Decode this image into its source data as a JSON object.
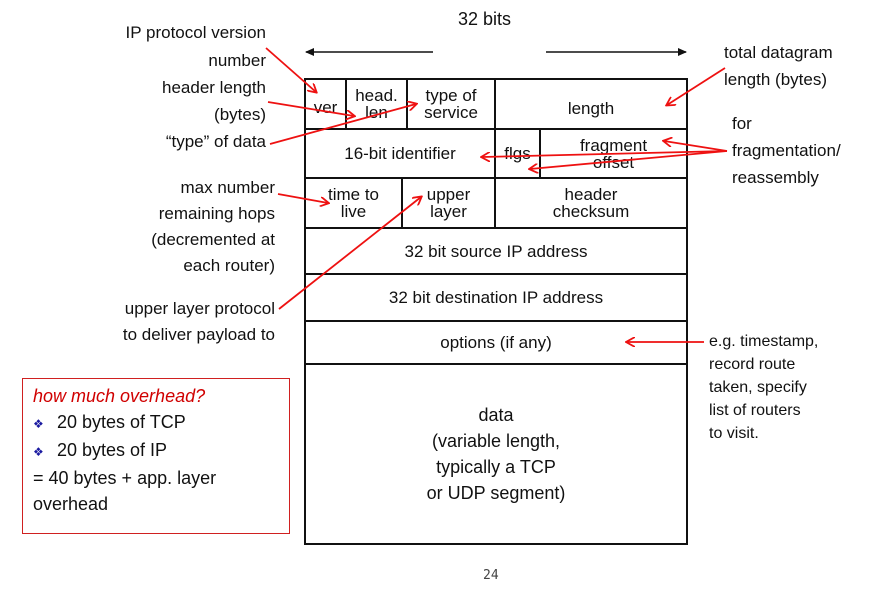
{
  "header": {
    "width_label": "32 bits"
  },
  "fields": {
    "ver": "ver",
    "head_len_1": "head.",
    "head_len_2": "len",
    "tos_1": "type of",
    "tos_2": "service",
    "length": "length",
    "identifier": "16-bit identifier",
    "flgs": "flgs",
    "frag_1": "fragment",
    "frag_2": "offset",
    "ttl_1": "time to",
    "ttl_2": "live",
    "upper_1": "upper",
    "upper_2": "layer",
    "checksum_1": "header",
    "checksum_2": "checksum",
    "src": "32 bit source IP address",
    "dst": "32 bit destination IP address",
    "options": "options (if any)",
    "data_1": "data",
    "data_2": "(variable length,",
    "data_3": "typically a TCP",
    "data_4": "or UDP segment)"
  },
  "left_annotations": {
    "version_1": "IP protocol version",
    "version_2": "number",
    "hlen_1": "header length",
    "hlen_2": "(bytes)",
    "tos": "“type” of data",
    "ttl_1": "max number",
    "ttl_2": "remaining hops",
    "ttl_3": "(decremented at",
    "ttl_4": "each router)",
    "proto_1": "upper layer protocol",
    "proto_2": "to deliver payload to"
  },
  "right_annotations": {
    "length_1": "total datagram",
    "length_2": "length (bytes)",
    "frag_1": "for",
    "frag_2": "fragmentation/",
    "frag_3": "reassembly",
    "options_1": "e.g. timestamp,",
    "options_2": "record route",
    "options_3": "taken, specify",
    "options_4": "list of routers",
    "options_5": "to visit."
  },
  "overhead_box": {
    "title": "how much overhead?",
    "items": [
      "20 bytes of TCP",
      "20 bytes of IP"
    ],
    "bullet_icon": "❖",
    "total_1": "= 40 bytes + app. layer",
    "total_2": "overhead"
  },
  "page_number": "24",
  "colors": {
    "arrow": "#ee1111",
    "accent_title": "#d00000",
    "bullet": "#1a1aa0"
  }
}
